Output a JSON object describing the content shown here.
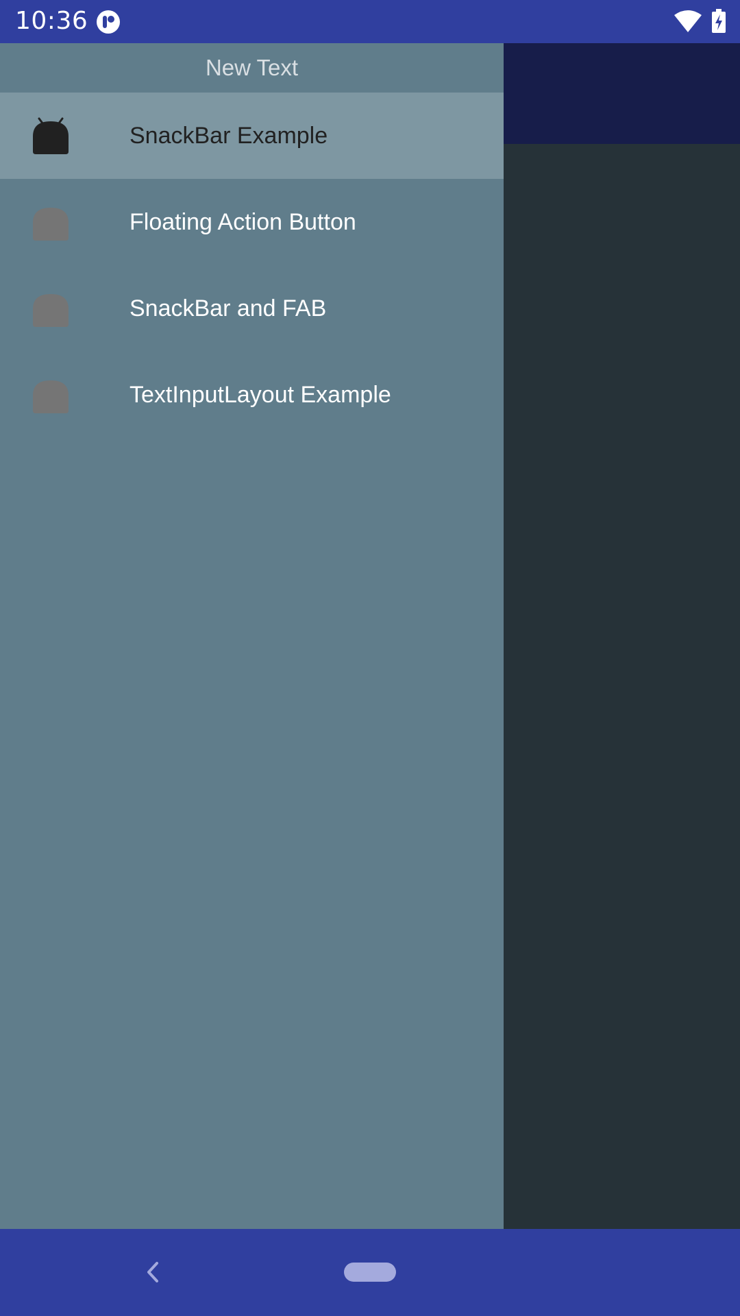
{
  "status_bar": {
    "time": "10:36",
    "icons": [
      "app-notification-icon",
      "wifi-icon",
      "battery-charging-icon"
    ]
  },
  "drawer": {
    "header_text": "New Text",
    "items": [
      {
        "label": "SnackBar Example",
        "icon": "android-icon",
        "selected": true
      },
      {
        "label": "Floating Action Button",
        "icon": "android-icon",
        "selected": false
      },
      {
        "label": "SnackBar and FAB",
        "icon": "android-icon",
        "selected": false
      },
      {
        "label": "TextInputLayout Example",
        "icon": "android-icon",
        "selected": false
      }
    ]
  },
  "nav_bar": {
    "icons": [
      "back-icon",
      "home-pill-icon"
    ]
  },
  "colors": {
    "status_bar": "#303F9F",
    "drawer_bg": "#607D8B",
    "selected_item_bg": "#7E97A2",
    "scrim_bg": "#263238",
    "toolbar_dim": "#171D4A",
    "nav_bar": "#303F9F"
  }
}
